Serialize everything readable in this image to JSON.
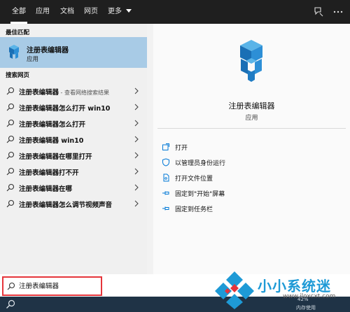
{
  "tabs": [
    {
      "label": "全部"
    },
    {
      "label": "应用"
    },
    {
      "label": "文档"
    },
    {
      "label": "网页"
    },
    {
      "label": "更多"
    }
  ],
  "left": {
    "best_match_heading": "最佳匹配",
    "best_match": {
      "title": "注册表编辑器",
      "subtitle": "应用"
    },
    "web_heading": "搜索网页",
    "web_results": [
      {
        "main": "注册表编辑器",
        "suffix": " - 查看网络搜索结果"
      },
      {
        "main": "注册表编辑器怎么打开 win10",
        "suffix": ""
      },
      {
        "main": "注册表编辑器怎么打开",
        "suffix": ""
      },
      {
        "main": "注册表编辑器 win10",
        "suffix": ""
      },
      {
        "main": "注册表编辑器在哪里打开",
        "suffix": ""
      },
      {
        "main": "注册表编辑器打不开",
        "suffix": ""
      },
      {
        "main": "注册表编辑器在哪",
        "suffix": ""
      },
      {
        "main": "注册表编辑器怎么调节视频声音",
        "suffix": ""
      }
    ]
  },
  "right": {
    "title": "注册表编辑器",
    "subtitle": "应用",
    "actions": [
      {
        "label": "打开",
        "icon": "open-icon"
      },
      {
        "label": "以管理员身份运行",
        "icon": "shield-icon"
      },
      {
        "label": "打开文件位置",
        "icon": "file-location-icon"
      },
      {
        "label": "固定到\"开始\"屏幕",
        "icon": "pin-icon"
      },
      {
        "label": "固定到任务栏",
        "icon": "pin-icon"
      }
    ]
  },
  "search": {
    "value": "注册表编辑器"
  },
  "taskbar": {
    "tray_top": "42%",
    "tray_bottom": "内存使用"
  },
  "watermark": {
    "name": "小小系统迷",
    "url": "www.iloxcxt.com"
  },
  "colors": {
    "topbar": "#1f1f1f",
    "selection": "#a8cbe6",
    "accent": "#0078d7",
    "search_border": "#e5353b",
    "watermark": "#1e9ad6"
  }
}
